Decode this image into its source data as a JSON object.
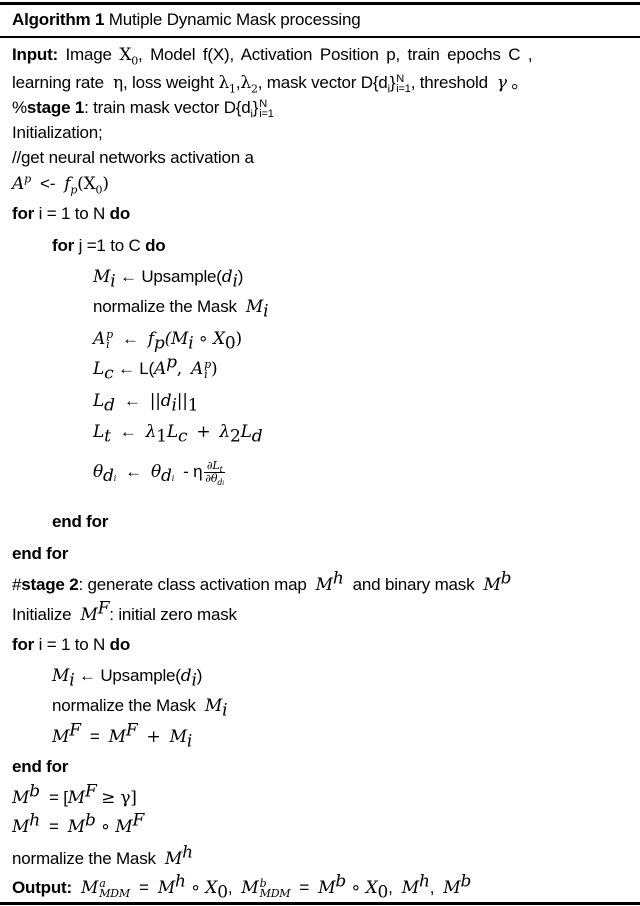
{
  "algorithm": {
    "number_label": "Algorithm 1",
    "title": "Mutiple Dynamic Mask processing",
    "input": {
      "label": "Input:",
      "line1": "Image X0 , Model f(X), Activation Position p, train epochs C ,",
      "line2": "learning rate η , loss weight λ1 , λ2 , mask vector D{di}N i=1 , threshold γ 。",
      "parts": {
        "image": "Image",
        "x0": "X",
        "x0_sub": "0",
        "model": ", Model f(X), Activation Position p, train epochs C ,",
        "lr": "learning rate",
        "eta": "η",
        "lw": ", loss weight",
        "lambda": "λ",
        "sub1": "1",
        "sub2": "2",
        "mv": ", mask vector D{d",
        "i": "i",
        "rb": "}",
        "N": "N",
        "i_eq_1": "i=1",
        "thr": ", threshold",
        "gamma": "γ",
        "end": "。"
      }
    },
    "stage1": {
      "prefix": "%",
      "bold": "stage 1",
      "text": ": train mask vector D{d",
      "i": "i",
      "rb": "}",
      "N": "N",
      "i_eq_1": "i=1"
    },
    "init": "Initialization;",
    "comment": "//get neural networks activation a",
    "activation": {
      "lhs": "A",
      "lhs_sup": "p",
      "arrow": "<-",
      "f": "f",
      "f_sub": "p",
      "arg": "(X",
      "arg_sub": "0",
      "close": ")"
    },
    "outer_for": {
      "kw_for": "for",
      "text": "i = 1 to N",
      "kw_do": "do"
    },
    "inner_for": {
      "kw_for": "for",
      "text": "j =1 to C",
      "kw_do": "do"
    },
    "inner_body": {
      "upsample": {
        "lhs": "M",
        "sub": "i",
        "arrow": "←",
        "fn": "Upsample(",
        "arg": "d",
        "arg_sub": "i",
        "close": ")"
      },
      "normalize": {
        "text": "normalize the Mask",
        "var": "M",
        "sub": "i"
      },
      "act_i": {
        "lhs": "A",
        "sup": "p",
        "sub": "i",
        "arrow": "←",
        "f": "f",
        "f_sub": "p",
        "arg": "(M",
        "arg_sub": "i",
        "circ": "∘",
        "x": "X",
        "x_sub": "0",
        "close": ")"
      },
      "lc": {
        "lhs": "L",
        "sub": "c",
        "arrow": "←",
        "fn": "L(",
        "a": "A",
        "a_sup": "p",
        "comma": ",",
        "ai": "A",
        "ai_sup": "p",
        "ai_sub": "i",
        "close": ")"
      },
      "ld": {
        "lhs": "L",
        "sub": "d",
        "arrow": "←",
        "open": "||d",
        "d_sub": "i",
        "close": "||",
        "norm_sub": "1"
      },
      "lt": {
        "lhs": "L",
        "sub": "t",
        "arrow": "←",
        "l1": "λ",
        "l1_sub": "1",
        "lc": "L",
        "lc_sub": "c",
        "plus": "+",
        "l2": "λ",
        "l2_sub": "2",
        "ld": "L",
        "ld_sub": "d"
      },
      "theta": {
        "lhs": "θ",
        "lhs_sub": "d",
        "lhs_subsub": "i",
        "arrow": "←",
        "rhs": "θ",
        "minus": "- η",
        "num": "∂L",
        "num_sub": "t",
        "den": "∂θ",
        "den_sub": "d",
        "den_subsub": "i"
      }
    },
    "inner_end": "end for",
    "outer_end": "end for",
    "stage2": {
      "prefix": "#",
      "bold": "stage 2",
      "text": ": generate class activation map",
      "mh": "M",
      "mh_sup": "h",
      "and": "and binary mask",
      "mb": "M",
      "mb_sup": "b"
    },
    "init_mf": {
      "text": "Initialize",
      "var": "M",
      "sup": "F",
      "rest": ": initial zero mask"
    },
    "loop2": {
      "for": {
        "kw_for": "for",
        "text": "i = 1 to N",
        "kw_do": "do"
      },
      "upsample": {
        "lhs": "M",
        "sub": "i",
        "arrow": "←",
        "fn": "Upsample(",
        "arg": "d",
        "arg_sub": "i",
        "close": ")"
      },
      "normalize": {
        "text": "normalize the Mask",
        "var": "M",
        "sub": "i"
      },
      "accum": {
        "lhs": "M",
        "lhs_sup": "F",
        "eq": "=",
        "a": "M",
        "a_sup": "F",
        "plus": "+",
        "b": "M",
        "b_sub": "i"
      },
      "end": "end for"
    },
    "binarize": {
      "lhs": "M",
      "lhs_sup": "b",
      "eq": "= [",
      "m": "M",
      "m_sup": "F",
      "ge": "≥ γ]"
    },
    "heatmap": {
      "lhs": "M",
      "lhs_sup": "h",
      "eq": "=",
      "a": "M",
      "a_sup": "b",
      "circ": "∘",
      "b": "M",
      "b_sup": "F"
    },
    "normalize_mh": {
      "text": "normalize the Mask",
      "var": "M",
      "sup": "h"
    },
    "output": {
      "label": "Output:",
      "ma": "M",
      "ma_sup": "a",
      "ma_sub": "MDM",
      "eq1": "=",
      "mh": "M",
      "mh_sup": "h",
      "circ1": "∘",
      "x1": "X",
      "x1_sub": "0",
      "comma1": ",",
      "mb": "M",
      "mb_sup": "b",
      "mb_sub": "MDM",
      "eq2": "=",
      "mb2": "M",
      "mb2_sup": "b",
      "circ2": "∘",
      "x2": "X",
      "x2_sub": "0",
      "comma2": ",",
      "mh3": "M",
      "mh3_sup": "h",
      "comma3": ",",
      "mb3": "M",
      "mb3_sup": "b"
    }
  }
}
